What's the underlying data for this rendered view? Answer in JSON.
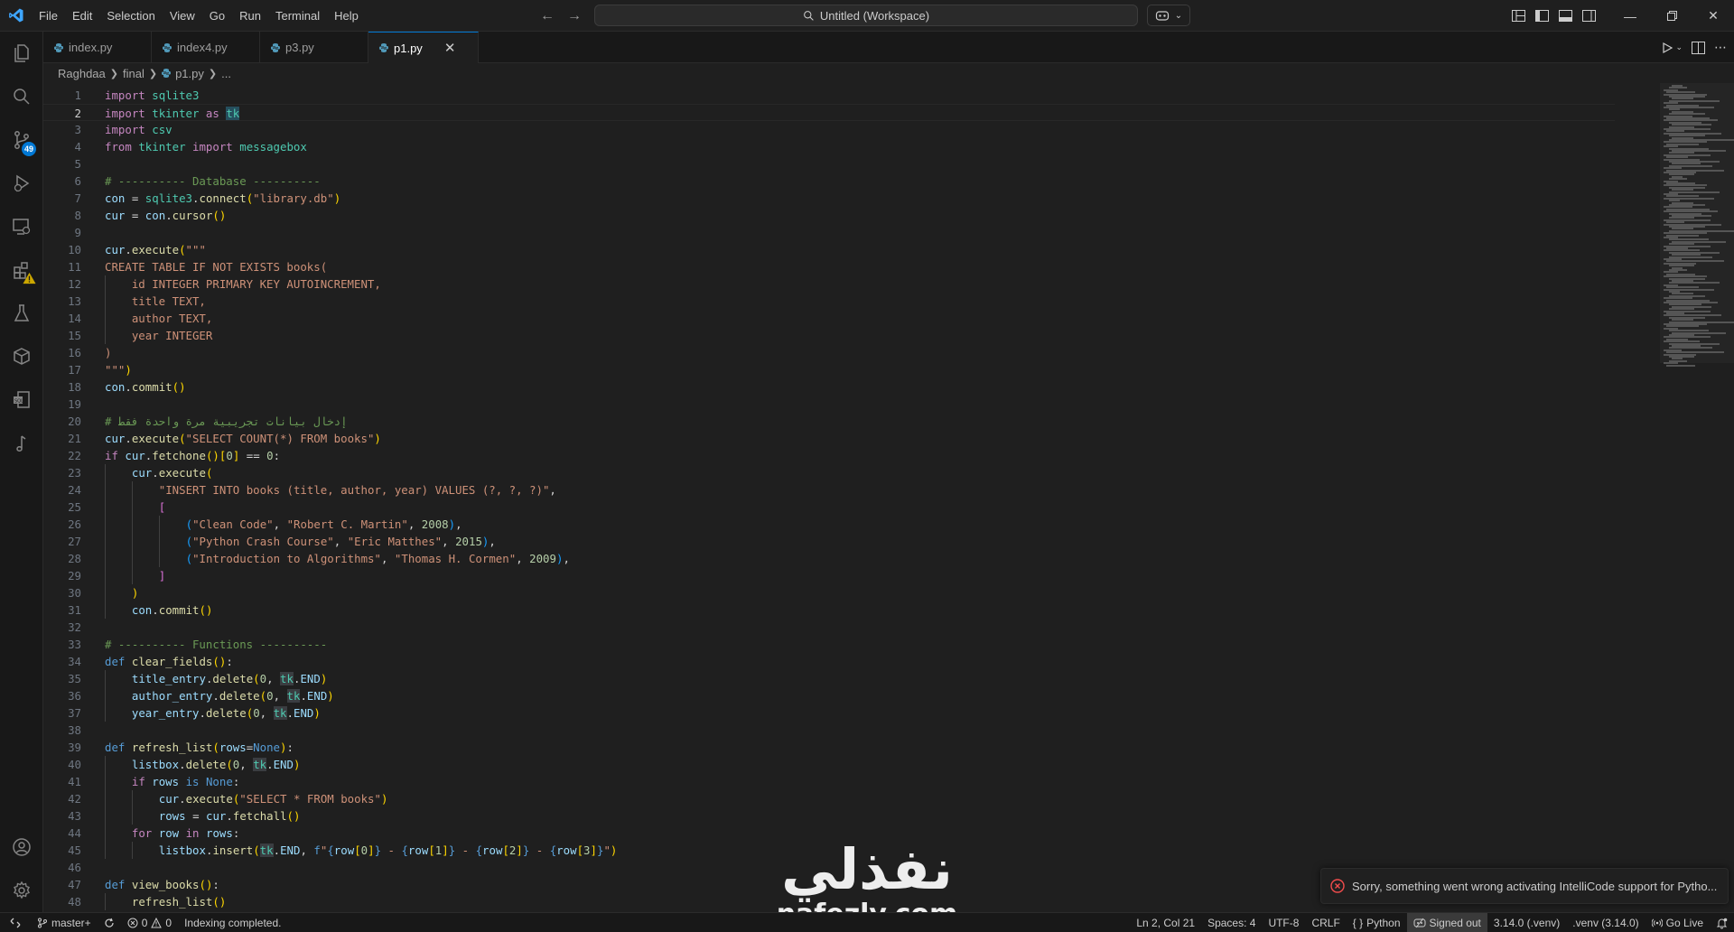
{
  "menu": [
    "File",
    "Edit",
    "Selection",
    "View",
    "Go",
    "Run",
    "Terminal",
    "Help"
  ],
  "command_center": "Untitled (Workspace)",
  "tabs": [
    {
      "label": "index.py"
    },
    {
      "label": "index4.py"
    },
    {
      "label": "p3.py"
    },
    {
      "label": "p1.py",
      "active": true
    }
  ],
  "breadcrumb": [
    "Raghdaa",
    "final",
    "p1.py",
    "..."
  ],
  "activity_badges": {
    "source_control": "49"
  },
  "code": [
    {
      "n": "1",
      "t": "import sqlite3"
    },
    {
      "n": "2",
      "t": "import tkinter as tk"
    },
    {
      "n": "3",
      "t": "import csv"
    },
    {
      "n": "4",
      "t": "from tkinter import messagebox"
    },
    {
      "n": "5",
      "t": ""
    },
    {
      "n": "6",
      "t": "# ---------- Database ----------"
    },
    {
      "n": "7",
      "t": "con = sqlite3.connect(\"library.db\")"
    },
    {
      "n": "8",
      "t": "cur = con.cursor()"
    },
    {
      "n": "9",
      "t": ""
    },
    {
      "n": "10",
      "t": "cur.execute(\"\"\""
    },
    {
      "n": "11",
      "t": "CREATE TABLE IF NOT EXISTS books("
    },
    {
      "n": "12",
      "t": "    id INTEGER PRIMARY KEY AUTOINCREMENT,"
    },
    {
      "n": "13",
      "t": "    title TEXT,"
    },
    {
      "n": "14",
      "t": "    author TEXT,"
    },
    {
      "n": "15",
      "t": "    year INTEGER"
    },
    {
      "n": "16",
      "t": ")"
    },
    {
      "n": "17",
      "t": "\"\"\")"
    },
    {
      "n": "18",
      "t": "con.commit()"
    },
    {
      "n": "19",
      "t": ""
    },
    {
      "n": "20",
      "t": "# إدخال بيانات تجريبية مرة واحدة فقط"
    },
    {
      "n": "21",
      "t": "cur.execute(\"SELECT COUNT(*) FROM books\")"
    },
    {
      "n": "22",
      "t": "if cur.fetchone()[0] == 0:"
    },
    {
      "n": "23",
      "t": "    cur.execute("
    },
    {
      "n": "24",
      "t": "        \"INSERT INTO books (title, author, year) VALUES (?, ?, ?)\","
    },
    {
      "n": "25",
      "t": "        ["
    },
    {
      "n": "26",
      "t": "            (\"Clean Code\", \"Robert C. Martin\", 2008),"
    },
    {
      "n": "27",
      "t": "            (\"Python Crash Course\", \"Eric Matthes\", 2015),"
    },
    {
      "n": "28",
      "t": "            (\"Introduction to Algorithms\", \"Thomas H. Cormen\", 2009),"
    },
    {
      "n": "29",
      "t": "        ]"
    },
    {
      "n": "30",
      "t": "    )"
    },
    {
      "n": "31",
      "t": "    con.commit()"
    },
    {
      "n": "32",
      "t": ""
    },
    {
      "n": "33",
      "t": "# ---------- Functions ----------"
    },
    {
      "n": "34",
      "t": "def clear_fields():"
    },
    {
      "n": "35",
      "t": "    title_entry.delete(0, tk.END)"
    },
    {
      "n": "36",
      "t": "    author_entry.delete(0, tk.END)"
    },
    {
      "n": "37",
      "t": "    year_entry.delete(0, tk.END)"
    },
    {
      "n": "38",
      "t": ""
    },
    {
      "n": "39",
      "t": "def refresh_list(rows=None):"
    },
    {
      "n": "40",
      "t": "    listbox.delete(0, tk.END)"
    },
    {
      "n": "41",
      "t": "    if rows is None:"
    },
    {
      "n": "42",
      "t": "        cur.execute(\"SELECT * FROM books\")"
    },
    {
      "n": "43",
      "t": "        rows = cur.fetchall()"
    },
    {
      "n": "44",
      "t": "    for row in rows:"
    },
    {
      "n": "45",
      "t": "        listbox.insert(tk.END, f\"{row[0]} - {row[1]} - {row[2]} - {row[3]}\")"
    },
    {
      "n": "46",
      "t": ""
    },
    {
      "n": "47",
      "t": "def view_books():"
    },
    {
      "n": "48",
      "t": "    refresh_list()"
    }
  ],
  "notification": "Sorry, something went wrong activating IntelliCode support for Pytho...",
  "watermark": {
    "arabic": "نفذلي",
    "latin": "nafezly.com"
  },
  "status": {
    "branch": "master+",
    "errors": "0",
    "warnings": "0",
    "message": "Indexing completed.",
    "position": "Ln 2, Col 21",
    "spaces": "Spaces: 4",
    "encoding": "UTF-8",
    "eol": "CRLF",
    "language": "Python",
    "account": "Signed out",
    "interpreter": "3.14.0 (.venv)",
    "venv": ".venv (3.14.0)",
    "live": "Go Live"
  },
  "colors": {
    "accent": "#0078d4",
    "error": "#f14c4c",
    "warning": "#cca700"
  }
}
